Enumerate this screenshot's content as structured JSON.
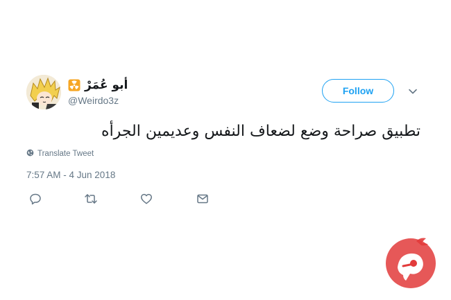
{
  "tweet": {
    "author": {
      "display_name": "أبو عُمَرْ",
      "handle": "@Weirdo3z",
      "badge_icon": "radioactive-icon"
    },
    "follow_label": "Follow",
    "text": "تطبيق صراحة وضع لضعاف النفس وعديمين الجرأه",
    "translate_label": "Translate Tweet",
    "timestamp": "7:57 AM - 4 Jun 2018",
    "actions": [
      "reply-icon",
      "retweet-icon",
      "like-icon",
      "message-icon"
    ]
  },
  "colors": {
    "accent": "#1da1f2",
    "secondary_text": "#657786",
    "primary_text": "#14171a",
    "watermark": "#e23b3b"
  }
}
